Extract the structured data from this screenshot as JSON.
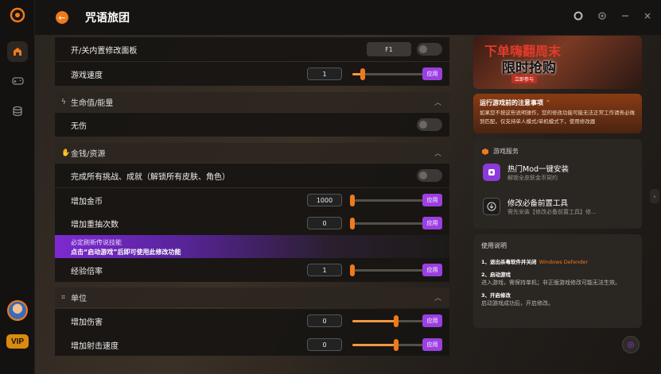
{
  "app": {
    "title": "咒语旅团"
  },
  "sidebar": {
    "vip_label": "VIP"
  },
  "rows": {
    "toggle_panel": {
      "label": "开/关内置修改面板",
      "hotkey": "F1"
    },
    "game_speed": {
      "label": "游戏速度",
      "value": "1",
      "apply": "应用",
      "level": 0.12
    },
    "invincible": {
      "label": "无伤"
    },
    "complete_all": {
      "label": "完成所有挑战、成就（解锁所有皮肤、角色）"
    },
    "add_gold": {
      "label": "增加金币",
      "value": "1000",
      "apply": "应用",
      "level": 0.0
    },
    "add_reroll": {
      "label": "增加重抽次数",
      "value": "0",
      "apply": "应用",
      "level": 0.0
    },
    "exp_mult": {
      "label": "经验倍率",
      "value": "1",
      "apply": "应用",
      "level": 0.0
    },
    "add_damage": {
      "label": "增加伤害",
      "value": "0",
      "apply": "应用",
      "level": 0.5
    },
    "add_fire_rate": {
      "label": "增加射击速度",
      "value": "0",
      "apply": "应用",
      "level": 0.5
    }
  },
  "sections": {
    "health": "生命值/能量",
    "money": "金钱/资源",
    "unit": "单位"
  },
  "promo": {
    "line1": "必定刷新传说技能",
    "line2": "点击“启动游戏”后即可使用此修改功能"
  },
  "ad": {
    "line1": "下单嗨翻周末",
    "line2": "限时抢购",
    "cta": "立即参与"
  },
  "notice": {
    "title": "运行游戏前的注意事项",
    "body": "如果您不按这些说明操作，您的修改功能可能无法正常工作请务必做到匹配，仅支持单人模式/单机模式下，使用修改器"
  },
  "services": {
    "header": "游戏服务",
    "items": [
      {
        "title": "热门Mod一键安装",
        "subtitle": "解锁全皮肤金币契约"
      },
      {
        "title": "修改必备前置工具",
        "subtitle": "需先安装【修改必备前置工具】修..."
      }
    ]
  },
  "usage": {
    "title": "使用说明",
    "step1_title": "1、退出杀毒软件并关闭",
    "step1_highlight": "Windows Defender",
    "step2_title": "2、启动游戏",
    "step2_body": "进入游戏，需保持单机；非正版游戏修改可能无法生效。",
    "step3_title": "3、开启修改",
    "step3_body": "启动游戏成功后，开启修改。"
  },
  "colors": {
    "accent": "#f07a1a",
    "apply": "#9b3fe0"
  }
}
